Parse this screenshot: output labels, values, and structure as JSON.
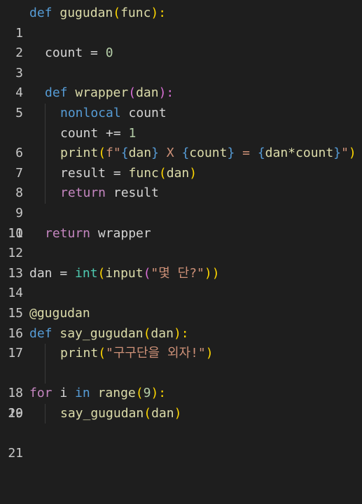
{
  "line_numbers": [
    "1",
    "2",
    "3",
    "4",
    "5",
    "6",
    "7",
    "8",
    "9",
    "10",
    "11",
    "12",
    "13",
    "14",
    "15",
    "16",
    "17",
    "18",
    "19",
    "20",
    "21"
  ],
  "tokens": {
    "l1": [
      "def",
      " ",
      "gugudan",
      "(",
      "func",
      "):"
    ],
    "l3": [
      "count",
      " = ",
      "0"
    ],
    "l5": [
      "def",
      " ",
      "wrapper",
      "(",
      "dan",
      "):"
    ],
    "l6": [
      "nonlocal",
      " ",
      "count"
    ],
    "l7": [
      "count",
      " += ",
      "1"
    ],
    "l8": [
      "print",
      "(",
      "f\"",
      "{",
      "dan",
      "}",
      " X ",
      "{",
      "count",
      "}",
      " = ",
      "{",
      "dan*count",
      "}",
      "\"",
      ")"
    ],
    "l9": [
      "result",
      " = ",
      "func",
      "(",
      "dan",
      ")"
    ],
    "l10": [
      "return",
      " ",
      "result"
    ],
    "l12": [
      "return",
      " ",
      "wrapper"
    ],
    "l14": [
      "dan",
      " = ",
      "int",
      "(",
      "input",
      "(",
      "\"몇 단?\"",
      "))"
    ],
    "l16": [
      "@gugudan"
    ],
    "l17": [
      "def",
      " ",
      "say_gugudan",
      "(",
      "dan",
      "):"
    ],
    "l18": [
      "print",
      "(",
      "\"구구단을 외자!\"",
      ")"
    ],
    "l20": [
      "for",
      " ",
      "i",
      " ",
      "in",
      " ",
      "range",
      "(",
      "9",
      "):"
    ],
    "l21": [
      "say_gugudan",
      "(",
      "dan",
      ")"
    ]
  },
  "colors": {
    "background": "#1e1e1e",
    "keyword": "#569cd6",
    "control": "#c586c0",
    "function": "#dcdcaa",
    "string": "#ce9178",
    "number": "#b5cea8",
    "builtin": "#4ec9b0",
    "bracket_level1": "#ffd700",
    "bracket_level2": "#da70d6"
  }
}
